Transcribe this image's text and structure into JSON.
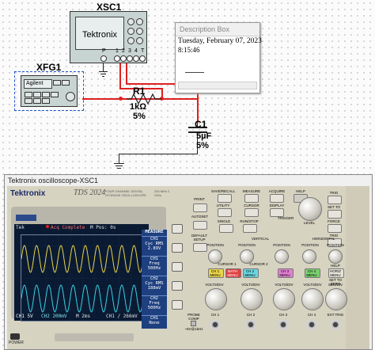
{
  "schematic": {
    "scope_ref": "XSC1",
    "scope_brand": "Tektronix",
    "scope_terminals": [
      "P",
      "1",
      "2",
      "3",
      "4",
      "T"
    ],
    "fgen_ref": "XFG1",
    "fgen_brand": "Agilent",
    "resistor": {
      "ref": "R1",
      "value": "1kΩ",
      "tolerance": "5%"
    },
    "capacitor": {
      "ref": "C1",
      "value": "5µF",
      "tolerance": "5%"
    },
    "wire_color": "#e02020"
  },
  "description_box": {
    "title": "Description Box",
    "line1": "Tuesday, February 07, 2023",
    "line2": "8:15:46"
  },
  "scope_window": {
    "title": "Tektronix oscilloscope-XSC1",
    "brand": "Tektronix",
    "model": "TDS 2024",
    "subtitle": "FOUR CHANNEL DIGITAL STORAGE OSCILLOSCOPE",
    "spec": "200 MHz 2 GS/s",
    "screen_top": {
      "left": "Tek",
      "status": "Acq Complete",
      "pos": "M Pos: 0s"
    },
    "measure": {
      "title": "MEASURE",
      "items": [
        {
          "label": "CH1",
          "type": "Cyc RMS",
          "value": "2.89V"
        },
        {
          "label": "CH1",
          "type": "Freq",
          "value": "500Hz"
        },
        {
          "label": "CH2",
          "type": "Cyc RMS",
          "value": "188mV"
        },
        {
          "label": "CH2",
          "type": "Freq",
          "value": "500Hz"
        },
        {
          "label": "CH1",
          "type": "None",
          "value": ""
        }
      ]
    },
    "screen_bottom": {
      "ch1": "CH1  5V",
      "ch2": "CH2 200mV",
      "time": "M 2ms",
      "trig": "CH1 / 266mV"
    },
    "ch1_color": "#e8d44a",
    "ch2_color": "#3ad0e0",
    "top_buttons": [
      "SAVE/RECALL",
      "MEASURE",
      "ACQUIRE",
      "HELP",
      "UTILITY",
      "CURSOR",
      "DISPLAY",
      "DEFAULT SETUP",
      "AUTOSET",
      "SINGLE SEQ",
      "RUN/STOP"
    ],
    "left_buttons": [
      "PRINT",
      "PRINT CHAN"
    ],
    "sections": {
      "vertical": "VERTICAL",
      "horizontal": "HORIZONTAL",
      "trigger": "TRIGGER"
    },
    "position_labels": [
      "POSITION",
      "POSITION",
      "POSITION",
      "POSITION",
      "POSITION"
    ],
    "cursor_labels": [
      "CURSOR 1",
      "CURSOR 2"
    ],
    "menu_buttons": [
      "CH 1 MENU",
      "MATH MENU",
      "CH 2 MENU",
      "CH 3 MENU",
      "CH 4 MENU",
      "HORIZ MENU"
    ],
    "volts_labels": [
      "VOLTS/DIV",
      "VOLTS/DIV",
      "VOLTS/DIV",
      "VOLTS/DIV",
      "SEC/DIV"
    ],
    "connectors": [
      "CH 1",
      "CH 2",
      "CH 3",
      "CH 4",
      "EXT TRIG"
    ],
    "right_buttons": [
      "TRIG MENU",
      "SET TO 50%",
      "FORCE TRIG",
      "TRIG VIEW",
      "HELP SCROLL",
      "SET TO ZERO"
    ],
    "level_label": "LEVEL",
    "power_label": "POWER",
    "probe_comp": "PROBE COMP",
    "probe_comp_value": "~5V@1kHz"
  }
}
